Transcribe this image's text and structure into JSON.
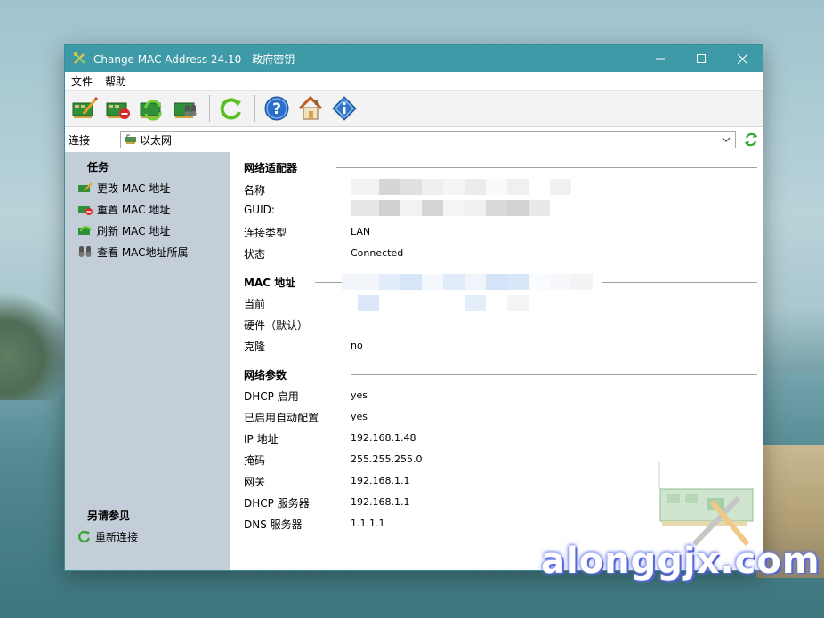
{
  "window": {
    "title": "Change MAC Address 24.10 - 政府密钥"
  },
  "menu": [
    "文件",
    "帮助"
  ],
  "toolbar": {
    "icons": [
      "card-edit-icon",
      "card-remove-icon",
      "card-refresh-icon",
      "card-search-icon",
      "refresh-icon",
      "help-icon",
      "home-icon",
      "info-icon"
    ]
  },
  "connection": {
    "label": "连接",
    "selected": "以太网"
  },
  "sidebar": {
    "tasks_title": "任务",
    "tasks": [
      "更改 MAC 地址",
      "重置 MAC 地址",
      "刷新 MAC 地址",
      "查看 MAC地址所属"
    ],
    "see_also_title": "另请参见",
    "see_also": [
      "重新连接"
    ]
  },
  "adapter": {
    "title": "网络适配器",
    "rows": [
      {
        "label": "名称",
        "value": ""
      },
      {
        "label": "GUID:",
        "value": ""
      },
      {
        "label": "连接类型",
        "value": "LAN"
      },
      {
        "label": "状态",
        "value": "Connected"
      }
    ]
  },
  "mac": {
    "title": "MAC 地址",
    "rows": [
      {
        "label": "当前",
        "value": ""
      },
      {
        "label": "硬件（默认）",
        "value": ""
      },
      {
        "label": "克隆",
        "value": "no"
      }
    ]
  },
  "params": {
    "title": "网络参数",
    "rows": [
      {
        "label": "DHCP 启用",
        "value": "yes"
      },
      {
        "label": "已启用自动配置",
        "value": "yes"
      },
      {
        "label": "IP 地址",
        "value": "192.168.1.48"
      },
      {
        "label": "掩码",
        "value": "255.255.255.0"
      },
      {
        "label": "网关",
        "value": "192.168.1.1"
      },
      {
        "label": "DHCP 服务器",
        "value": "192.168.1.1"
      },
      {
        "label": "DNS 服务器",
        "value": "1.1.1.1"
      }
    ]
  },
  "watermark": "alonggjx.com",
  "colors": {
    "titlebar": "#3f9aa8",
    "sidebar": "#c4ced8",
    "accent_green": "#3aa63a",
    "help_blue": "#2a6fc9"
  }
}
